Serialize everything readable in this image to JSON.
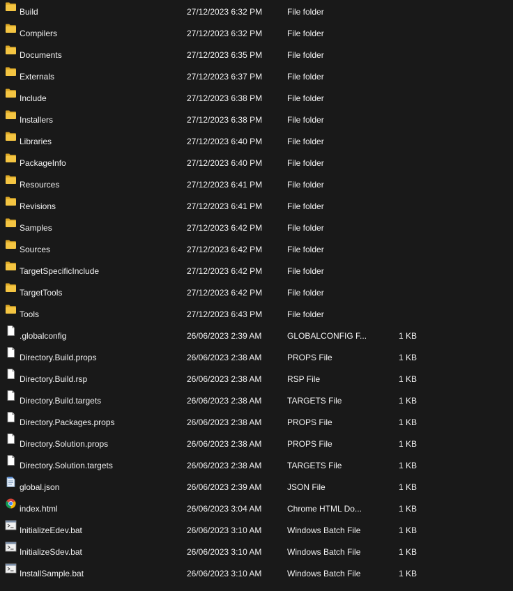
{
  "files": [
    {
      "name": "Build",
      "date": "27/12/2023 6:32 PM",
      "type": "File folder",
      "size": "",
      "icon": "folder-icon"
    },
    {
      "name": "Compilers",
      "date": "27/12/2023 6:32 PM",
      "type": "File folder",
      "size": "",
      "icon": "folder-icon"
    },
    {
      "name": "Documents",
      "date": "27/12/2023 6:35 PM",
      "type": "File folder",
      "size": "",
      "icon": "folder-icon"
    },
    {
      "name": "Externals",
      "date": "27/12/2023 6:37 PM",
      "type": "File folder",
      "size": "",
      "icon": "folder-icon"
    },
    {
      "name": "Include",
      "date": "27/12/2023 6:38 PM",
      "type": "File folder",
      "size": "",
      "icon": "folder-icon"
    },
    {
      "name": "Installers",
      "date": "27/12/2023 6:38 PM",
      "type": "File folder",
      "size": "",
      "icon": "folder-icon"
    },
    {
      "name": "Libraries",
      "date": "27/12/2023 6:40 PM",
      "type": "File folder",
      "size": "",
      "icon": "folder-icon"
    },
    {
      "name": "PackageInfo",
      "date": "27/12/2023 6:40 PM",
      "type": "File folder",
      "size": "",
      "icon": "folder-icon"
    },
    {
      "name": "Resources",
      "date": "27/12/2023 6:41 PM",
      "type": "File folder",
      "size": "",
      "icon": "folder-icon"
    },
    {
      "name": "Revisions",
      "date": "27/12/2023 6:41 PM",
      "type": "File folder",
      "size": "",
      "icon": "folder-icon"
    },
    {
      "name": "Samples",
      "date": "27/12/2023 6:42 PM",
      "type": "File folder",
      "size": "",
      "icon": "folder-icon"
    },
    {
      "name": "Sources",
      "date": "27/12/2023 6:42 PM",
      "type": "File folder",
      "size": "",
      "icon": "folder-icon"
    },
    {
      "name": "TargetSpecificInclude",
      "date": "27/12/2023 6:42 PM",
      "type": "File folder",
      "size": "",
      "icon": "folder-icon"
    },
    {
      "name": "TargetTools",
      "date": "27/12/2023 6:42 PM",
      "type": "File folder",
      "size": "",
      "icon": "folder-icon"
    },
    {
      "name": "Tools",
      "date": "27/12/2023 6:43 PM",
      "type": "File folder",
      "size": "",
      "icon": "folder-icon"
    },
    {
      "name": ".globalconfig",
      "date": "26/06/2023 2:39 AM",
      "type": "GLOBALCONFIG F...",
      "size": "1 KB",
      "icon": "file-icon"
    },
    {
      "name": "Directory.Build.props",
      "date": "26/06/2023 2:38 AM",
      "type": "PROPS File",
      "size": "1 KB",
      "icon": "file-icon"
    },
    {
      "name": "Directory.Build.rsp",
      "date": "26/06/2023 2:38 AM",
      "type": "RSP File",
      "size": "1 KB",
      "icon": "file-icon"
    },
    {
      "name": "Directory.Build.targets",
      "date": "26/06/2023 2:38 AM",
      "type": "TARGETS File",
      "size": "1 KB",
      "icon": "file-icon"
    },
    {
      "name": "Directory.Packages.props",
      "date": "26/06/2023 2:38 AM",
      "type": "PROPS File",
      "size": "1 KB",
      "icon": "file-icon"
    },
    {
      "name": "Directory.Solution.props",
      "date": "26/06/2023 2:38 AM",
      "type": "PROPS File",
      "size": "1 KB",
      "icon": "file-icon"
    },
    {
      "name": "Directory.Solution.targets",
      "date": "26/06/2023 2:38 AM",
      "type": "TARGETS File",
      "size": "1 KB",
      "icon": "file-icon"
    },
    {
      "name": "global.json",
      "date": "26/06/2023 2:39 AM",
      "type": "JSON File",
      "size": "1 KB",
      "icon": "json-file-icon"
    },
    {
      "name": "index.html",
      "date": "26/06/2023 3:04 AM",
      "type": "Chrome HTML Do...",
      "size": "1 KB",
      "icon": "chrome-icon"
    },
    {
      "name": "InitializeEdev.bat",
      "date": "26/06/2023 3:10 AM",
      "type": "Windows Batch File",
      "size": "1 KB",
      "icon": "batch-file-icon"
    },
    {
      "name": "InitializeSdev.bat",
      "date": "26/06/2023 3:10 AM",
      "type": "Windows Batch File",
      "size": "1 KB",
      "icon": "batch-file-icon"
    },
    {
      "name": "InstallSample.bat",
      "date": "26/06/2023 3:10 AM",
      "type": "Windows Batch File",
      "size": "1 KB",
      "icon": "batch-file-icon"
    }
  ],
  "colors": {
    "background": "#191919",
    "folder": "#f4c542",
    "folder_dark": "#dba726"
  }
}
